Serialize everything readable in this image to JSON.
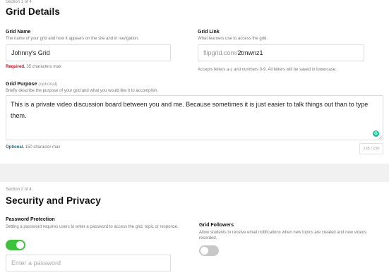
{
  "section1": {
    "label": "Section 1 of 4",
    "title": "Grid Details",
    "grid_name": {
      "label": "Grid Name",
      "description": "The name of your grid and how it appears on the site and in navigation.",
      "value": "Johnny's Grid",
      "required_label": "Required.",
      "required_note": "35 characters max"
    },
    "grid_link": {
      "label": "Grid Link",
      "description": "What learners use to access the grid.",
      "prefix": "flipgrid.com/",
      "value": "2tmwnz1",
      "note": "Accepts letters a-z and numbers 0-9. All letters will be saved in lowercase."
    },
    "grid_purpose": {
      "label": "Grid Purpose",
      "optional_tag": "(optional)",
      "description": "Briefly describe the purpose of your grid and what you would like it to accomplish.",
      "value": "This is a private video discussion board between you and me. Because sometimes it is just easier to talk things out than to type them.",
      "optional_label": "Optional.",
      "note": "150 character max",
      "counter": "135 / 150"
    }
  },
  "section2": {
    "label": "Section 2 of 4",
    "title": "Security and Privacy",
    "password": {
      "label": "Password Protection",
      "description": "Setting a password requires users to enter a password to access the grid, topic or response.",
      "toggle_on": true,
      "placeholder": "Enter a password"
    },
    "followers": {
      "label": "Grid Followers",
      "description": "Allow students to receive email notifications when new topics are created and new videos recorded.",
      "toggle_on": false
    }
  },
  "colors": {
    "toggle_on": "#3cc23c",
    "toggle_off": "#c8c8c8",
    "required": "#d0021b",
    "optional": "#1f6f8b",
    "grammarly": "#15c39a"
  },
  "icons": {
    "grammarly": "grammarly-icon",
    "resize": "resize-handle-icon"
  }
}
